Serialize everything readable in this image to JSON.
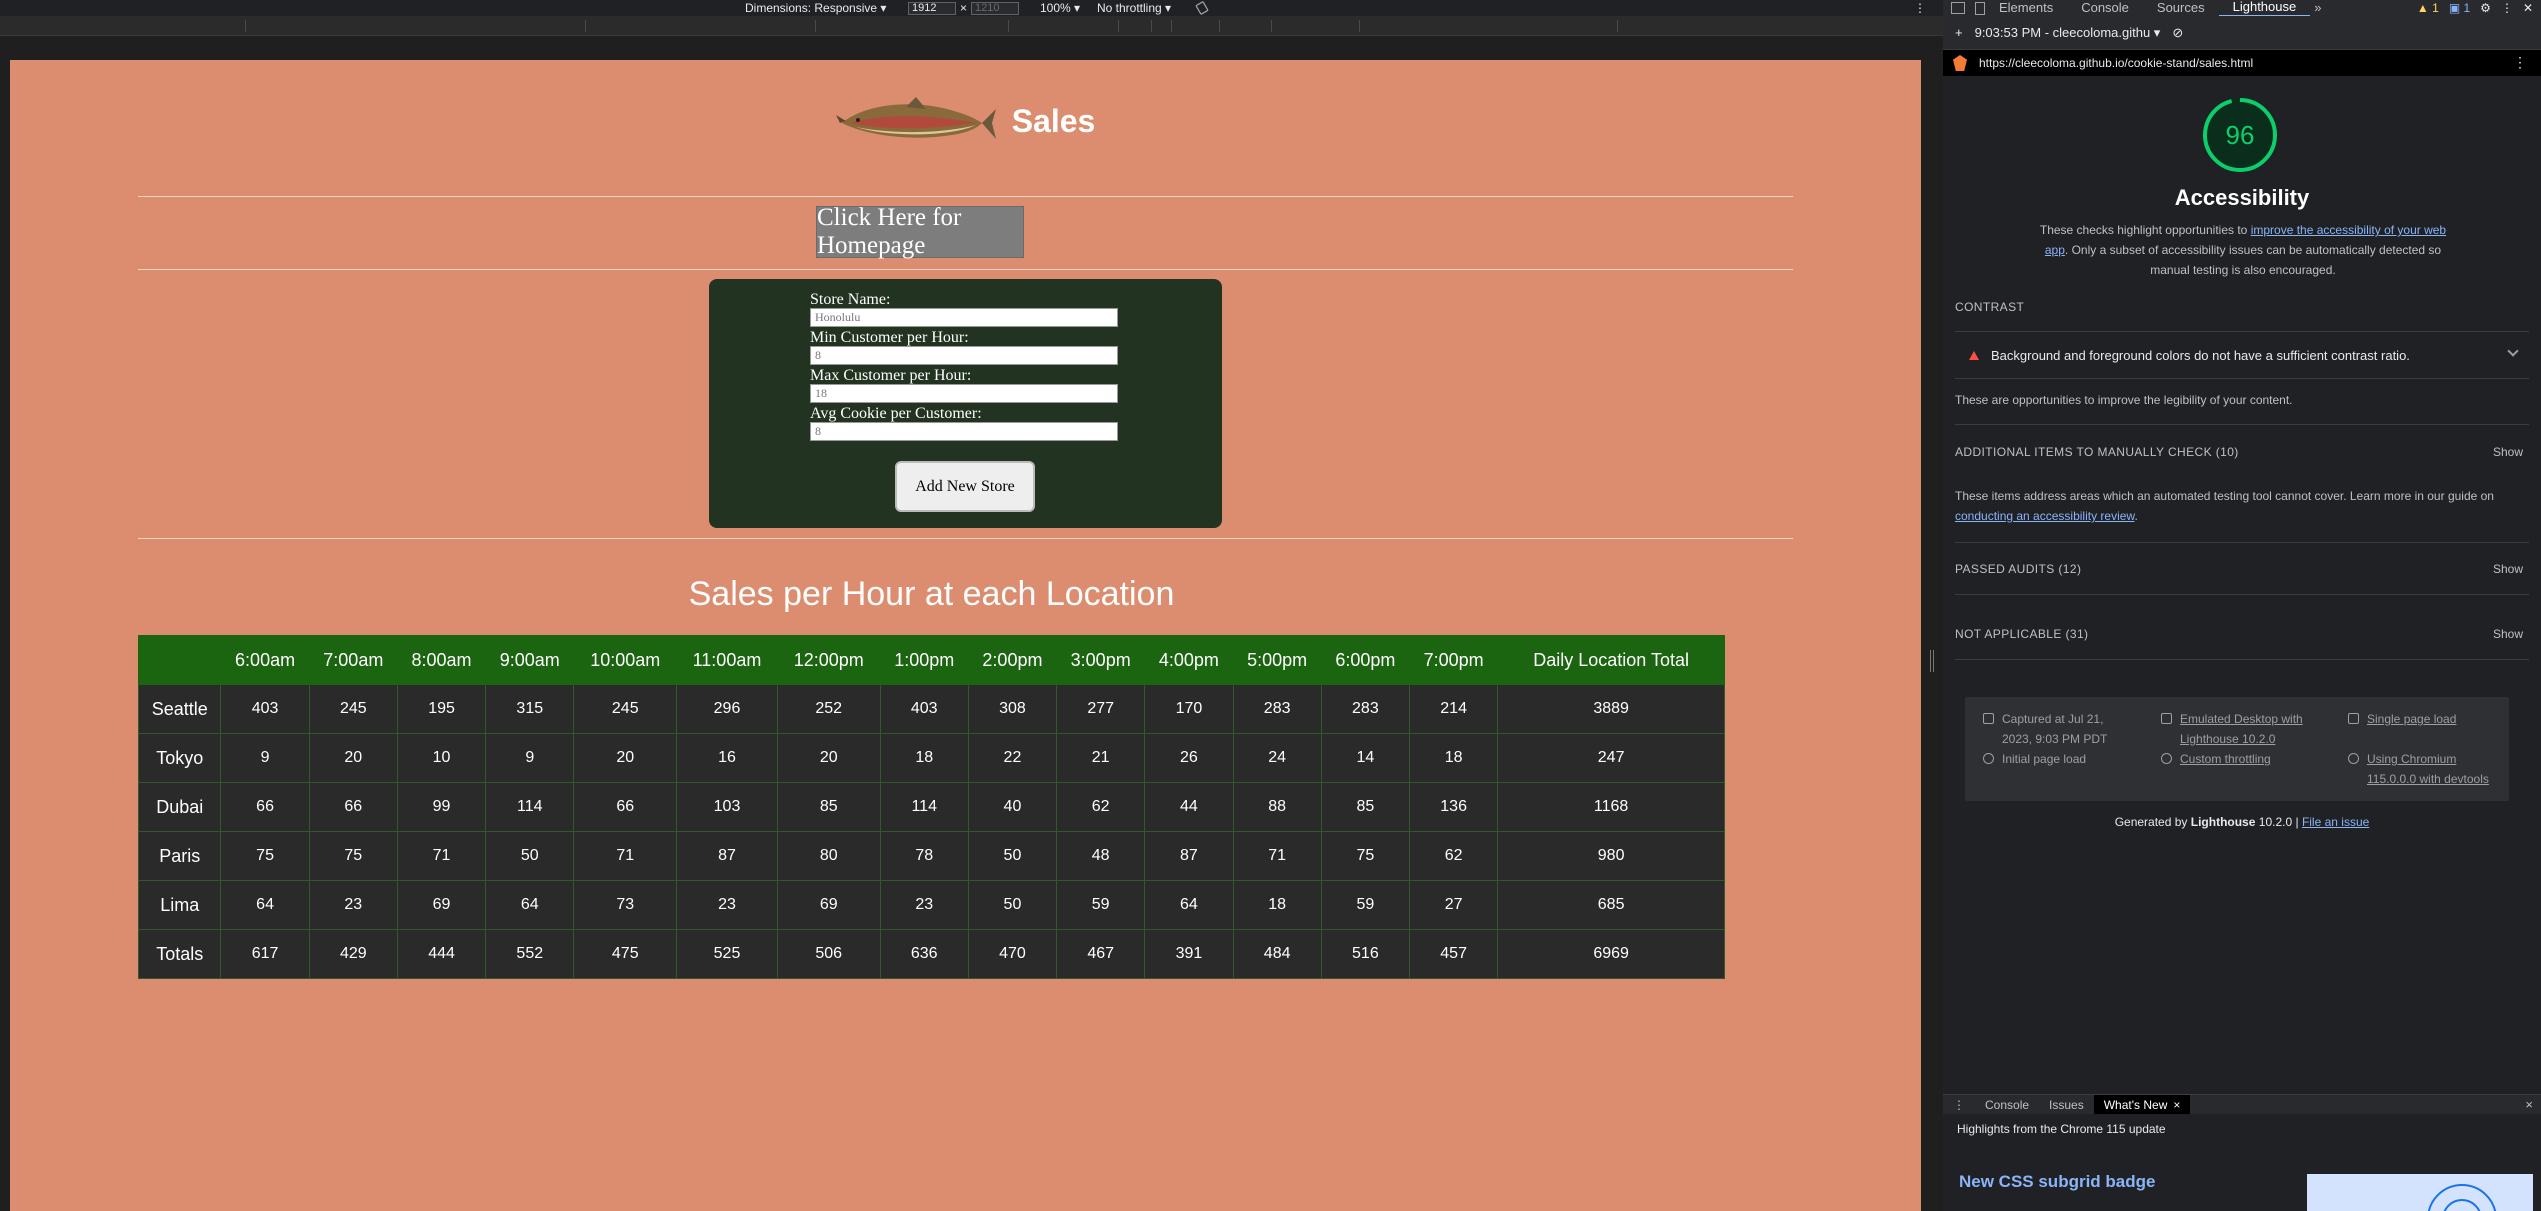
{
  "device_toolbar": {
    "dimensions_label": "Dimensions: Responsive ▾",
    "width_value": "1912",
    "height_placeholder": "1210",
    "times": "×",
    "zoom": "100% ▾",
    "throttling": "No throttling ▾",
    "menu": "⋮"
  },
  "page": {
    "title": "Sales",
    "home_button": "Click Here for Homepage",
    "form": {
      "labels": [
        "Store Name:",
        "Min Customer per Hour:",
        "Max Customer per Hour:",
        "Avg Cookie per Customer:"
      ],
      "placeholders": [
        "Honolulu",
        "8",
        "18",
        "8"
      ],
      "submit": "Add New Store"
    },
    "table_title": "Sales per Hour at each Location",
    "table": {
      "headers": [
        "",
        "6:00am",
        "7:00am",
        "8:00am",
        "9:00am",
        "10:00am",
        "11:00am",
        "12:00pm",
        "1:00pm",
        "2:00pm",
        "3:00pm",
        "4:00pm",
        "5:00pm",
        "6:00pm",
        "7:00pm",
        "Daily Location Total"
      ],
      "rows": [
        [
          "Seattle",
          "403",
          "245",
          "195",
          "315",
          "245",
          "296",
          "252",
          "403",
          "308",
          "277",
          "170",
          "283",
          "283",
          "214",
          "3889"
        ],
        [
          "Tokyo",
          "9",
          "20",
          "10",
          "9",
          "20",
          "16",
          "20",
          "18",
          "22",
          "21",
          "26",
          "24",
          "14",
          "18",
          "247"
        ],
        [
          "Dubai",
          "66",
          "66",
          "99",
          "114",
          "66",
          "103",
          "85",
          "114",
          "40",
          "62",
          "44",
          "88",
          "85",
          "136",
          "1168"
        ],
        [
          "Paris",
          "75",
          "75",
          "71",
          "50",
          "71",
          "87",
          "80",
          "78",
          "50",
          "48",
          "87",
          "71",
          "75",
          "62",
          "980"
        ],
        [
          "Lima",
          "64",
          "23",
          "69",
          "64",
          "73",
          "23",
          "69",
          "23",
          "50",
          "59",
          "64",
          "18",
          "59",
          "27",
          "685"
        ],
        [
          "Totals",
          "617",
          "429",
          "444",
          "552",
          "475",
          "525",
          "506",
          "636",
          "470",
          "467",
          "391",
          "484",
          "516",
          "457",
          "6969"
        ]
      ]
    }
  },
  "devtools": {
    "tabs": [
      "Elements",
      "Console",
      "Sources",
      "Lighthouse"
    ],
    "more_tabs": "»",
    "warn_count": "1",
    "info_count": "1",
    "report_selector": "9:03:53 PM - cleecoloma.githu ▾",
    "url": "https://cleecoloma.github.io/cookie-stand/sales.html",
    "score": "96",
    "category": "Accessibility",
    "desc_prefix": "These checks highlight opportunities to",
    "desc_link": "improve the accessibility of your web app",
    "desc_suffix": ". Only a subset of accessibility issues can be automatically detected so manual testing is also encouraged.",
    "contrast_header": "CONTRAST",
    "contrast_audit": "Background and foreground colors do not have a sufficient contrast ratio.",
    "contrast_note": "These are opportunities to improve the legibility of your content.",
    "manual_header": "ADDITIONAL ITEMS TO MANUALLY CHECK",
    "manual_count": "(10)",
    "manual_text": "These items address areas which an automated testing tool cannot cover. Learn more in our guide on",
    "manual_link": "conducting an accessibility review",
    "passed_header": "PASSED AUDITS",
    "passed_count": "(12)",
    "na_header": "NOT APPLICABLE",
    "na_count": "(31)",
    "show": "Show",
    "env": {
      "captured": "Captured at Jul 21, 2023, 9:03 PM PDT",
      "initial": "Initial page load",
      "emulated": "Emulated Desktop with Lighthouse 10.2.0",
      "custom": "Custom throttling",
      "single": "Single page load",
      "chromium": "Using Chromium 115.0.0.0 with devtools"
    },
    "generated_prefix": "Generated by",
    "generated_brand": "Lighthouse",
    "generated_version": "10.2.0 |",
    "file_issue": "File an issue",
    "drawer_tabs": [
      "Console",
      "Issues",
      "What's New"
    ],
    "drawer_close_tab": "×",
    "drawer_close": "×",
    "highlights": "Highlights from the Chrome 115 update",
    "whatsnew_title": "New CSS subgrid badge"
  },
  "colors": {
    "page_bg": "#dc8d6f",
    "form_bg": "#223322",
    "table_header": "#1b6410",
    "table_cell": "#2a2a2a",
    "score_green": "#0cce6b",
    "fail_red": "#ff4e42",
    "link_blue": "#8ab4f8"
  },
  "icons": [
    "fish-logo",
    "dock-icon",
    "rotate-icon",
    "inspect-icon",
    "device-icon",
    "settings-icon",
    "lighthouse-icon",
    "plus-icon",
    "clear-icon",
    "warning-icon",
    "chevron-down-icon",
    "calendar-icon",
    "timer-icon",
    "laptop-icon",
    "wifi-icon",
    "page-icon",
    "chromium-icon"
  ]
}
